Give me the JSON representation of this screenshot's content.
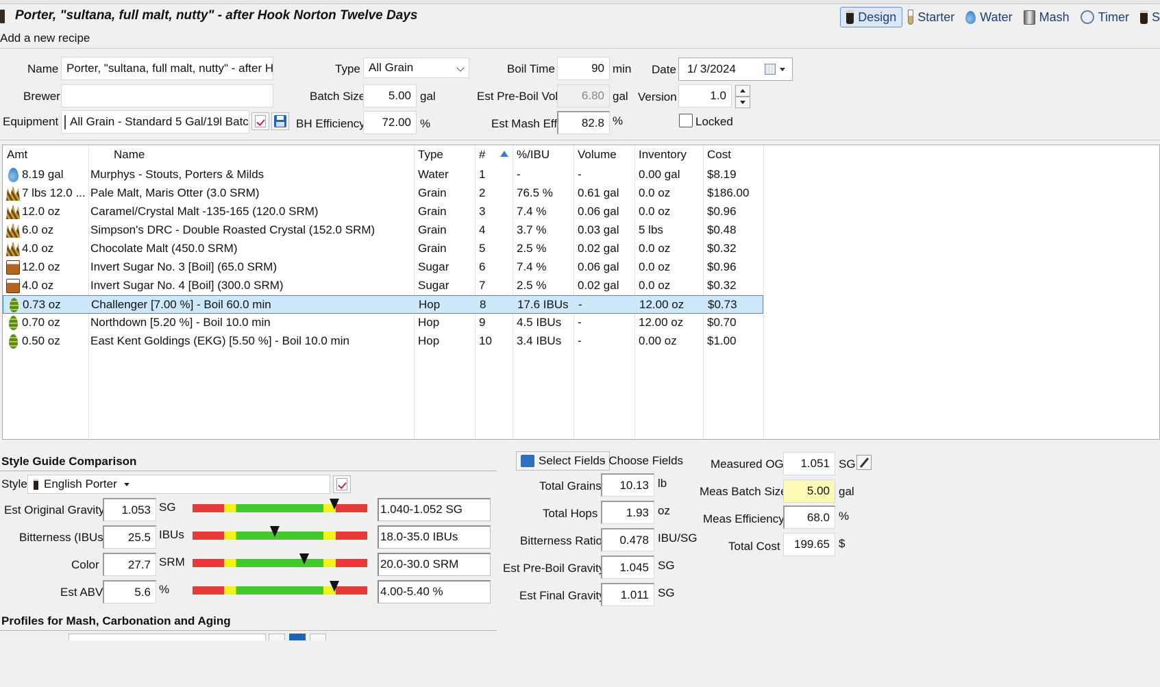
{
  "recipe_title": "Porter, \"sultana, full malt, nutty\" - after Hook Norton Twelve Days",
  "subtitle": "Add a new recipe",
  "toolbar": [
    {
      "label": "Design",
      "icon": "pint-icon",
      "active": true
    },
    {
      "label": "Starter",
      "icon": "test-tube-icon"
    },
    {
      "label": "Water",
      "icon": "water-drop-icon"
    },
    {
      "label": "Mash",
      "icon": "mash-tun-icon"
    },
    {
      "label": "Timer",
      "icon": "clock-icon"
    },
    {
      "label": "S",
      "icon": "pint-icon"
    }
  ],
  "form": {
    "name_label": "Name",
    "name_value": "Porter, \"sultana, full malt, nutty\" - after Hc",
    "brewer_label": "Brewer",
    "brewer_value": "",
    "equipment_label": "Equipment",
    "equipment_value": "All Grain - Standard 5 Gal/19l Batc",
    "type_label": "Type",
    "type_value": "All Grain",
    "batch_label": "Batch Size",
    "batch_value": "5.00",
    "batch_unit": "gal",
    "bh_label": "BH Efficiency",
    "bh_value": "72.00",
    "bh_unit": "%",
    "boil_label": "Boil Time",
    "boil_value": "90",
    "boil_unit": "min",
    "preboil_label": "Est Pre-Boil Vol",
    "preboil_value": "6.80",
    "preboil_unit": "gal",
    "masheff_label": "Est Mash Eff",
    "masheff_value": "82.8",
    "masheff_unit": "%",
    "date_label": "Date",
    "date_value": "1/  3/2024",
    "version_label": "Version",
    "version_value": "1.0",
    "locked_label": "Locked"
  },
  "table": {
    "headers": [
      "Amt",
      "Name",
      "Type",
      "#",
      "%/IBU",
      "Volume",
      "Inventory",
      "Cost"
    ],
    "rows": [
      {
        "icon": "water",
        "amt": "8.19 gal",
        "name": "Murphys - Stouts, Porters & Milds",
        "type": "Water",
        "num": "1",
        "pct": "-",
        "vol": "-",
        "inv": "0.00 gal",
        "cost": "$8.19"
      },
      {
        "icon": "grain",
        "amt": "7 lbs 12.0 ...",
        "name": "Pale Malt, Maris Otter (3.0 SRM)",
        "type": "Grain",
        "num": "2",
        "pct": "76.5 %",
        "vol": "0.61 gal",
        "inv": "0.0 oz",
        "cost": "$186.00"
      },
      {
        "icon": "grain",
        "amt": "12.0 oz",
        "name": "Caramel/Crystal Malt -135-165 (120.0 SRM)",
        "type": "Grain",
        "num": "3",
        "pct": "7.4 %",
        "vol": "0.06 gal",
        "inv": "0.0 oz",
        "cost": "$0.96"
      },
      {
        "icon": "grain",
        "amt": "6.0 oz",
        "name": "Simpson's DRC - Double Roasted Crystal (152.0 SRM)",
        "type": "Grain",
        "num": "4",
        "pct": "3.7 %",
        "vol": "0.03 gal",
        "inv": "5 lbs",
        "cost": "$0.48"
      },
      {
        "icon": "grain",
        "amt": "4.0 oz",
        "name": "Chocolate Malt (450.0 SRM)",
        "type": "Grain",
        "num": "5",
        "pct": "2.5 %",
        "vol": "0.02 gal",
        "inv": "0.0 oz",
        "cost": "$0.32"
      },
      {
        "icon": "sugar",
        "amt": "12.0 oz",
        "name": "Invert Sugar No. 3 [Boil] (65.0 SRM)",
        "type": "Sugar",
        "num": "6",
        "pct": "7.4 %",
        "vol": "0.06 gal",
        "inv": "0.0 oz",
        "cost": "$0.96"
      },
      {
        "icon": "sugar",
        "amt": "4.0 oz",
        "name": "Invert Sugar No. 4 [Boil] (300.0 SRM)",
        "type": "Sugar",
        "num": "7",
        "pct": "2.5 %",
        "vol": "0.02 gal",
        "inv": "0.0 oz",
        "cost": "$0.32"
      },
      {
        "icon": "hop",
        "amt": "0.73 oz",
        "name": "Challenger [7.00 %] - Boil 60.0 min",
        "type": "Hop",
        "num": "8",
        "pct": "17.6 IBUs",
        "vol": "-",
        "inv": "12.00 oz",
        "cost": "$0.73",
        "selected": true
      },
      {
        "icon": "hop",
        "amt": "0.70 oz",
        "name": "Northdown [5.20 %] - Boil 10.0 min",
        "type": "Hop",
        "num": "9",
        "pct": "4.5 IBUs",
        "vol": "-",
        "inv": "12.00 oz",
        "cost": "$0.70"
      },
      {
        "icon": "hop",
        "amt": "0.50 oz",
        "name": "East Kent Goldings (EKG) [5.50 %] - Boil 10.0 min",
        "type": "Hop",
        "num": "10",
        "pct": "3.4 IBUs",
        "vol": "-",
        "inv": "0.00 oz",
        "cost": "$1.00"
      }
    ]
  },
  "style": {
    "section_title": "Style Guide Comparison",
    "style_label": "Style",
    "style_value": "English Porter",
    "rows": [
      {
        "label": "Est Original Gravity",
        "value": "1.053",
        "unit": "SG",
        "range": "1.040-1.052 SG",
        "marker_fraction": 0.81
      },
      {
        "label": "Bitterness (IBUs)",
        "value": "25.5",
        "unit": "IBUs",
        "range": "18.0-35.0 IBUs",
        "marker_fraction": 0.47
      },
      {
        "label": "Color",
        "value": "27.7",
        "unit": "SRM",
        "range": "20.0-30.0 SRM",
        "marker_fraction": 0.64
      },
      {
        "label": "Est ABV",
        "value": "5.6",
        "unit": "%",
        "range": "4.00-5.40 %",
        "marker_fraction": 0.81
      }
    ]
  },
  "fields": {
    "select_label": "Select Fields",
    "choose_label": "- Choose Fields",
    "rows": [
      {
        "label": "Total Grains",
        "value": "10.13",
        "unit": "lb"
      },
      {
        "label": "Total Hops",
        "value": "1.93",
        "unit": "oz"
      },
      {
        "label": "Bitterness Ratio",
        "value": "0.478",
        "unit": "IBU/SG"
      },
      {
        "label": "Est Pre-Boil Gravity",
        "value": "1.045",
        "unit": "SG"
      },
      {
        "label": "Est Final Gravity",
        "value": "1.011",
        "unit": "SG"
      }
    ]
  },
  "measured": {
    "rows": [
      {
        "label": "Measured OG",
        "value": "1.051",
        "unit": "SG"
      },
      {
        "label": "Meas Batch Size",
        "value": "5.00",
        "unit": "gal"
      },
      {
        "label": "Meas Efficiency",
        "value": "68.0",
        "unit": "%"
      },
      {
        "label": "Total Cost",
        "value": "199.65",
        "unit": "$"
      }
    ]
  },
  "profiles_title": "Profiles for Mash, Carbonation and Aging"
}
